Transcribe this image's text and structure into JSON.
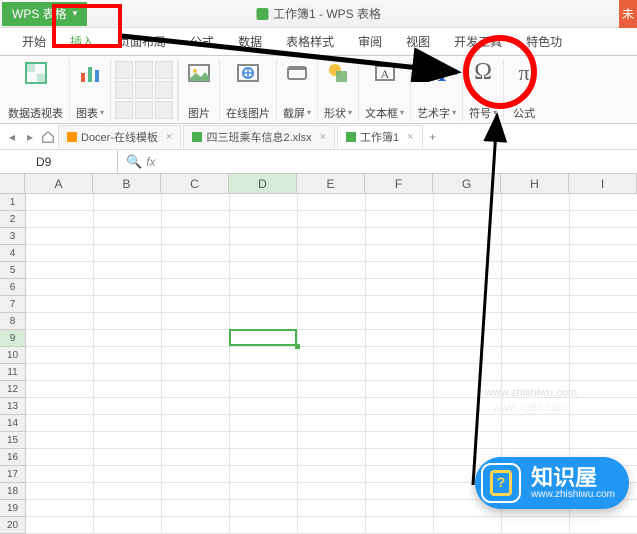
{
  "app": {
    "name": "WPS 表格",
    "doc_title": "工作簿1 - WPS 表格",
    "unsaved_badge": "未"
  },
  "menu": {
    "items": [
      "开始",
      "插入",
      "页面布局",
      "公式",
      "数据",
      "表格样式",
      "审阅",
      "视图",
      "开发工具",
      "特色功"
    ],
    "active_index": 1
  },
  "ribbon": {
    "pivot": "数据透视表",
    "chart": "图表",
    "picture": "图片",
    "online_pic": "在线图片",
    "screenshot": "截屏",
    "shapes": "形状",
    "textbox": "文本框",
    "wordart": "艺术字",
    "symbol": "符号",
    "formula": "公式"
  },
  "doctabs": {
    "docer": "Docer-在线模板",
    "file1": "四三班乘车信息2.xlsx",
    "file2": "工作簿1"
  },
  "namebox": {
    "cell_ref": "D9",
    "fx": "fx"
  },
  "grid": {
    "cols": [
      "A",
      "B",
      "C",
      "D",
      "E",
      "F",
      "G",
      "H",
      "I"
    ],
    "row_count": 20,
    "selected_col": "D",
    "selected_row": 9
  },
  "watermarks": {
    "url1": "www.zhishiwu.com",
    "url2": "www.xp85.com"
  },
  "badge": {
    "title": "知识屋",
    "sub": "www.zhishiwu.com"
  }
}
